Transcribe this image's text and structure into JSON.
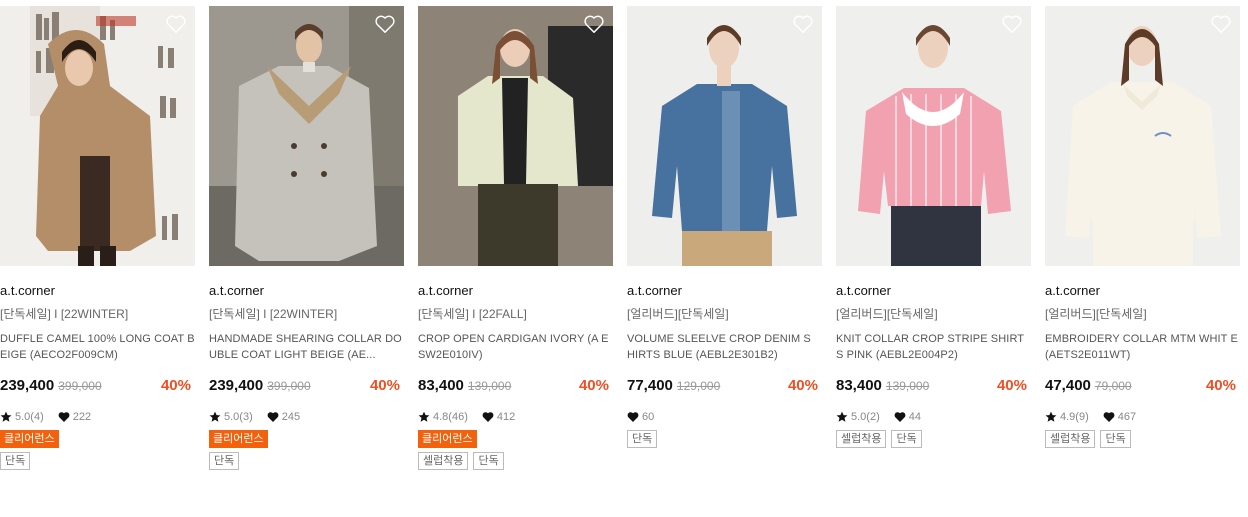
{
  "colors": {
    "discount": "#f04e23",
    "clearance_badge": "#f4610d"
  },
  "products": [
    {
      "brand": "a.t.corner",
      "tags": "[단독세일] I [22WINTER]",
      "name": "DUFFLE CAMEL 100% LONG COAT BEIGE (AECO2F009CM)",
      "price": "239,400",
      "original_price": "399,000",
      "discount": "40%",
      "rating": "5.0(4)",
      "likes": "222",
      "fill_badges": [
        "클리어런스"
      ],
      "line_badges": [
        "단독"
      ],
      "heart_icon": "heart-outline-icon"
    },
    {
      "brand": "a.t.corner",
      "tags": "[단독세일] I [22WINTER]",
      "name": "HANDMADE SHEARING COLLAR DOUBLE COAT LIGHT BEIGE (AE...",
      "price": "239,400",
      "original_price": "399,000",
      "discount": "40%",
      "rating": "5.0(3)",
      "likes": "245",
      "fill_badges": [
        "클리어런스"
      ],
      "line_badges": [
        "단독"
      ],
      "heart_icon": "heart-outline-icon"
    },
    {
      "brand": "a.t.corner",
      "tags": "[단독세일] I [22FALL]",
      "name": "CROP OPEN CARDIGAN IVORY (A ESW2E010IV)",
      "price": "83,400",
      "original_price": "139,000",
      "discount": "40%",
      "rating": "4.8(46)",
      "likes": "412",
      "fill_badges": [
        "클리어런스"
      ],
      "line_badges": [
        "셀럽착용",
        "단독"
      ],
      "heart_icon": "heart-outline-icon"
    },
    {
      "brand": "a.t.corner",
      "tags": "[얼리버드][단독세일]",
      "name": "VOLUME SLEELVE CROP DENIM S HIRTS BLUE (AEBL2E301B2)",
      "price": "77,400",
      "original_price": "129,000",
      "discount": "40%",
      "rating": "",
      "likes": "60",
      "fill_badges": [],
      "line_badges": [
        "단독"
      ],
      "heart_icon": "heart-outline-icon"
    },
    {
      "brand": "a.t.corner",
      "tags": "[얼리버드][단독세일]",
      "name": "KNIT COLLAR CROP STRIPE SHIRT S PINK (AEBL2E004P2)",
      "price": "83,400",
      "original_price": "139,000",
      "discount": "40%",
      "rating": "5.0(2)",
      "likes": "44",
      "fill_badges": [],
      "line_badges": [
        "셀럽착용",
        "단독"
      ],
      "heart_icon": "heart-outline-icon"
    },
    {
      "brand": "a.t.corner",
      "tags": "[얼리버드][단독세일]",
      "name": "EMBROIDERY COLLAR MTM WHIT E (AETS2E011WT)",
      "price": "47,400",
      "original_price": "79,000",
      "discount": "40%",
      "rating": "4.9(9)",
      "likes": "467",
      "fill_badges": [],
      "line_badges": [
        "셀럽착용",
        "단독"
      ],
      "heart_icon": "heart-outline-icon"
    }
  ]
}
